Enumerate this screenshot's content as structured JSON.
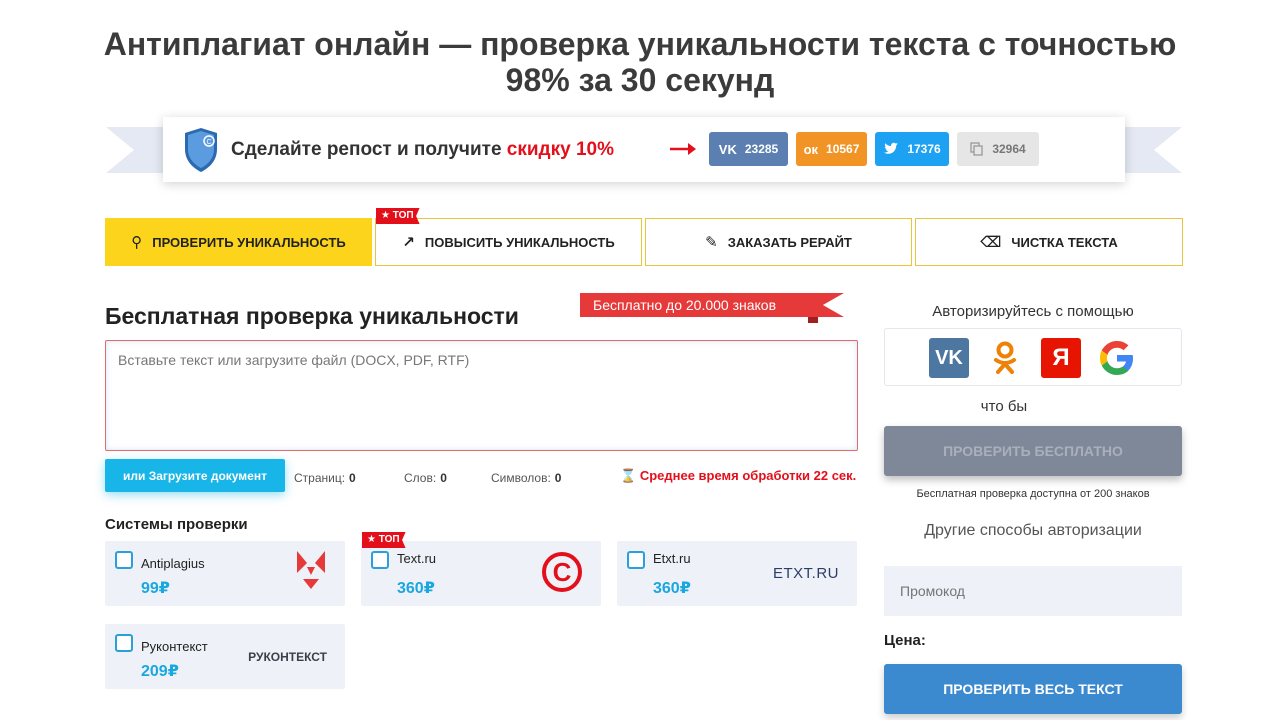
{
  "title": "Антиплагиат онлайн — проверка уникальности текста с точностью 98% за 30 секунд",
  "share": {
    "text": "Сделайте репост и получите ",
    "highlight": "скидку 10%",
    "buttons": [
      {
        "network": "vk",
        "icon": "vk-icon",
        "count": "23285",
        "color": "#5a7fb0"
      },
      {
        "network": "ok",
        "icon": "odnoklassniki-icon",
        "count": "10567",
        "color": "#f29425"
      },
      {
        "network": "twitter",
        "icon": "twitter-icon",
        "count": "17376",
        "color": "#1da1f2"
      },
      {
        "network": "copy",
        "icon": "copy-icon",
        "count": "32964",
        "color": "#e6e6e6"
      }
    ]
  },
  "tabs": [
    {
      "label": "ПРОВЕРИТЬ УНИКАЛЬНОСТЬ",
      "icon": "search-icon",
      "active": true
    },
    {
      "label": "ПОВЫСИТЬ УНИКАЛЬНОСТЬ",
      "icon": "trending-up-icon",
      "badge": "★ ТОП"
    },
    {
      "label": "ЗАКАЗАТЬ РЕРАЙТ",
      "icon": "edit-icon"
    },
    {
      "label": "ЧИСТКА ТЕКСТА",
      "icon": "eraser-icon"
    }
  ],
  "main": {
    "heading": "Бесплатная проверка уникальности",
    "free_flag": "Бесплатно до 20.000 знаков",
    "textarea_placeholder": "Вставьте текст или загрузите файл (DOCX, PDF, RTF)",
    "upload_label": "или Загрузите документ",
    "stats": {
      "pages_label": "Страниц:",
      "pages": "0",
      "words_label": "Слов:",
      "words": "0",
      "chars_label": "Символов:",
      "chars": "0"
    },
    "avg_time": "Среднее время обработки 22 сек."
  },
  "systems": {
    "title": "Системы проверки",
    "items": [
      {
        "name": "Antiplagius",
        "price": "99₽",
        "logo": "antiplagius-logo"
      },
      {
        "name": "Text.ru",
        "price": "360₽",
        "logo": "textru-copyright-logo",
        "badge": "★ ТОП"
      },
      {
        "name": "Etxt.ru",
        "price": "360₽",
        "logo_text": "ETXT.RU"
      },
      {
        "name": "Руконтекст",
        "price": "209₽",
        "logo_text": "РУКОНТЕКСТ"
      }
    ]
  },
  "sidebar": {
    "auth_title": "Авторизируйтесь с помощью",
    "auth_providers": [
      {
        "name": "vk",
        "icon": "vk-icon",
        "label": "VK",
        "color": "#4d76a1"
      },
      {
        "name": "ok",
        "icon": "odnoklassniki-icon",
        "label": "ok",
        "color": "#ee8208"
      },
      {
        "name": "yandex",
        "icon": "yandex-icon",
        "label": "Я",
        "color": "#e61400"
      },
      {
        "name": "google",
        "icon": "google-icon",
        "label": "G",
        "color": "#4285f4"
      }
    ],
    "so_that": "что бы",
    "check_free": "ПРОВЕРИТЬ БЕСПЛАТНО",
    "free_note": "Бесплатная проверка доступна от 200 знаков",
    "other_auth": "Другие способы авторизации",
    "promo_placeholder": "Промокод",
    "price_label": "Цена:",
    "check_all": "ПРОВЕРИТЬ ВЕСЬ ТЕКСТ"
  }
}
